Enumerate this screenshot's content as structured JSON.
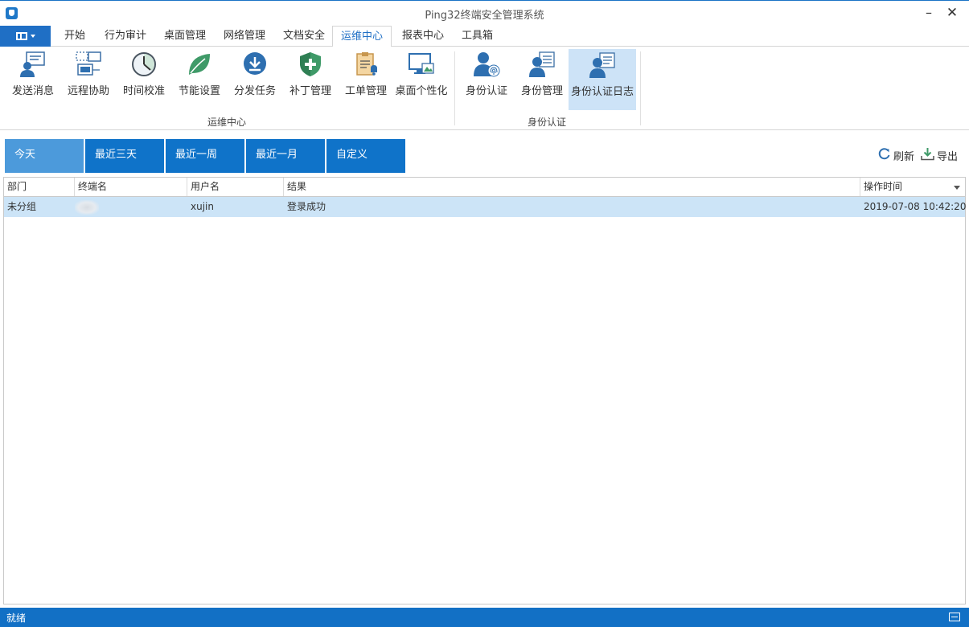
{
  "window": {
    "title": "Ping32终端安全管理系统",
    "minimize": "–",
    "close": "✕"
  },
  "menu": {
    "app_button_icon": "panel-icon",
    "tabs": [
      {
        "label": "开始"
      },
      {
        "label": "行为审计"
      },
      {
        "label": "桌面管理"
      },
      {
        "label": "网络管理"
      },
      {
        "label": "文档安全"
      },
      {
        "label": "运维中心",
        "active": true
      },
      {
        "label": "报表中心"
      },
      {
        "label": "工具箱"
      }
    ]
  },
  "ribbon": {
    "groups": [
      {
        "label": "运维中心",
        "buttons": [
          {
            "label": "发送消息",
            "icon": "send-message-icon"
          },
          {
            "label": "远程协助",
            "icon": "remote-assist-icon"
          },
          {
            "label": "时间校准",
            "icon": "clock-icon"
          },
          {
            "label": "节能设置",
            "icon": "leaf-icon"
          },
          {
            "label": "分发任务",
            "icon": "download-icon"
          },
          {
            "label": "补丁管理",
            "icon": "shield-icon"
          },
          {
            "label": "工单管理",
            "icon": "clipboard-icon"
          },
          {
            "label": "桌面个性化",
            "icon": "desktop-icon"
          }
        ]
      },
      {
        "label": "身份认证",
        "buttons": [
          {
            "label": "身份认证",
            "icon": "fingerprint-user-icon"
          },
          {
            "label": "身份管理",
            "icon": "user-list-icon"
          },
          {
            "label": "身份认证日志",
            "icon": "user-log-icon",
            "selected": true
          }
        ]
      }
    ]
  },
  "filters": {
    "ranges": [
      {
        "label": "今天",
        "active": true
      },
      {
        "label": "最近三天"
      },
      {
        "label": "最近一周"
      },
      {
        "label": "最近一月"
      },
      {
        "label": "自定义"
      }
    ],
    "refresh_label": "刷新",
    "export_label": "导出"
  },
  "table": {
    "columns": [
      "部门",
      "终端名",
      "用户名",
      "结果",
      "操作时间"
    ],
    "rows": [
      {
        "dept": "未分组",
        "terminal": "",
        "user": "xujin",
        "result": "登录成功",
        "time": "2019-07-08 10:42:20",
        "selected": true
      }
    ]
  },
  "status": {
    "text": "就绪"
  },
  "colors": {
    "accent": "#1f6fc5",
    "selected_row": "#cce4f7",
    "status_bar": "#1270c5"
  }
}
